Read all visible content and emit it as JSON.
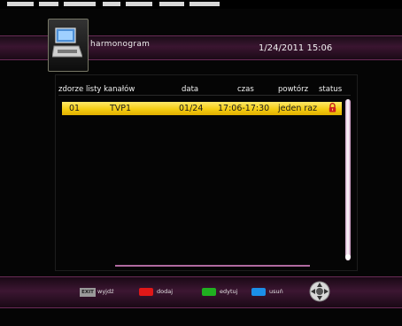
{
  "header": {
    "title": "harmonogram",
    "datetime": "1/24/2011 15:06"
  },
  "table": {
    "columns": [
      "zdorze listy kanałów",
      "data",
      "czas",
      "powtórz",
      "status"
    ],
    "rows": [
      {
        "index": "01",
        "channel": "TVP1",
        "date": "01/24",
        "time": "17:06-17:30",
        "repeat": "jeden raz",
        "status": "lock-icon"
      }
    ]
  },
  "footer": {
    "exit_key": "EXIT",
    "exit_label": "wyjdź",
    "red_label": "dodaj",
    "green_label": "edytuj",
    "blue_label": "usuń"
  },
  "colors": {
    "highlight": "#f5cd12",
    "bar": "#3a1530",
    "red": "#e01818",
    "green": "#20b020",
    "blue": "#1b8fe8"
  }
}
